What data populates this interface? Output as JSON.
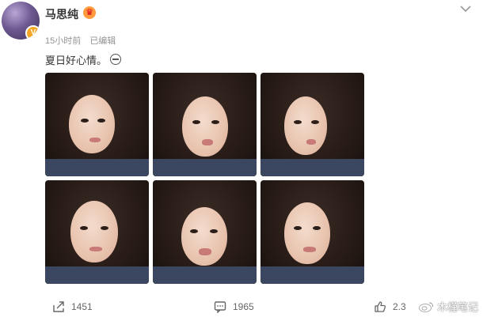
{
  "post": {
    "username": "马思纯",
    "avatar_badge": "V",
    "crown_glyph": "♛",
    "time": "15小时前",
    "edited": "已编辑",
    "text": "夏日好心情。"
  },
  "photos": [
    {
      "label": "selfie-1"
    },
    {
      "label": "selfie-2"
    },
    {
      "label": "selfie-3"
    },
    {
      "label": "selfie-4"
    },
    {
      "label": "selfie-5"
    },
    {
      "label": "selfie-6"
    }
  ],
  "actions": {
    "share_count": "1451",
    "comment_count": "1965",
    "like_count": "2.3"
  },
  "watermark": {
    "text": "木槿笔记"
  },
  "icons": {
    "menu": "chevron-down-icon",
    "share": "share-icon",
    "comment": "comment-icon",
    "like": "thumbs-up-icon",
    "emoji": "emoji-icon"
  },
  "colors": {
    "text": "#333333",
    "meta": "#939393",
    "vip_badge": "#f5a623"
  }
}
